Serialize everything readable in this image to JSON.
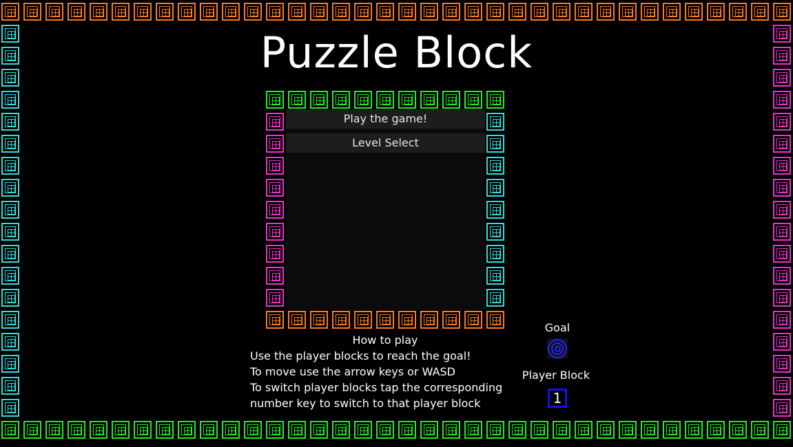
{
  "title": "Puzzle Block",
  "menu": {
    "play_label": "Play the game!",
    "level_select_label": "Level Select"
  },
  "howto": {
    "title": "How to play",
    "lines": [
      "Use the player blocks to reach the goal!",
      "To move use the arrow keys or WASD",
      "To switch player blocks tap the corresponding",
      "number key to switch to that player block"
    ]
  },
  "legend": {
    "goal_label": "Goal",
    "player_label": "Player Block",
    "player_number": "1"
  },
  "colors": {
    "orange": "#ff7a1a",
    "green": "#22ee22",
    "cyan": "#33dddd",
    "magenta": "#ee33cc",
    "goal_blue": "#2222ff",
    "player_blue": "#1111ee"
  },
  "icons": {
    "border_tile": "quad-square-tile-icon",
    "goal": "concentric-rings-icon",
    "player": "numbered-square-icon"
  }
}
